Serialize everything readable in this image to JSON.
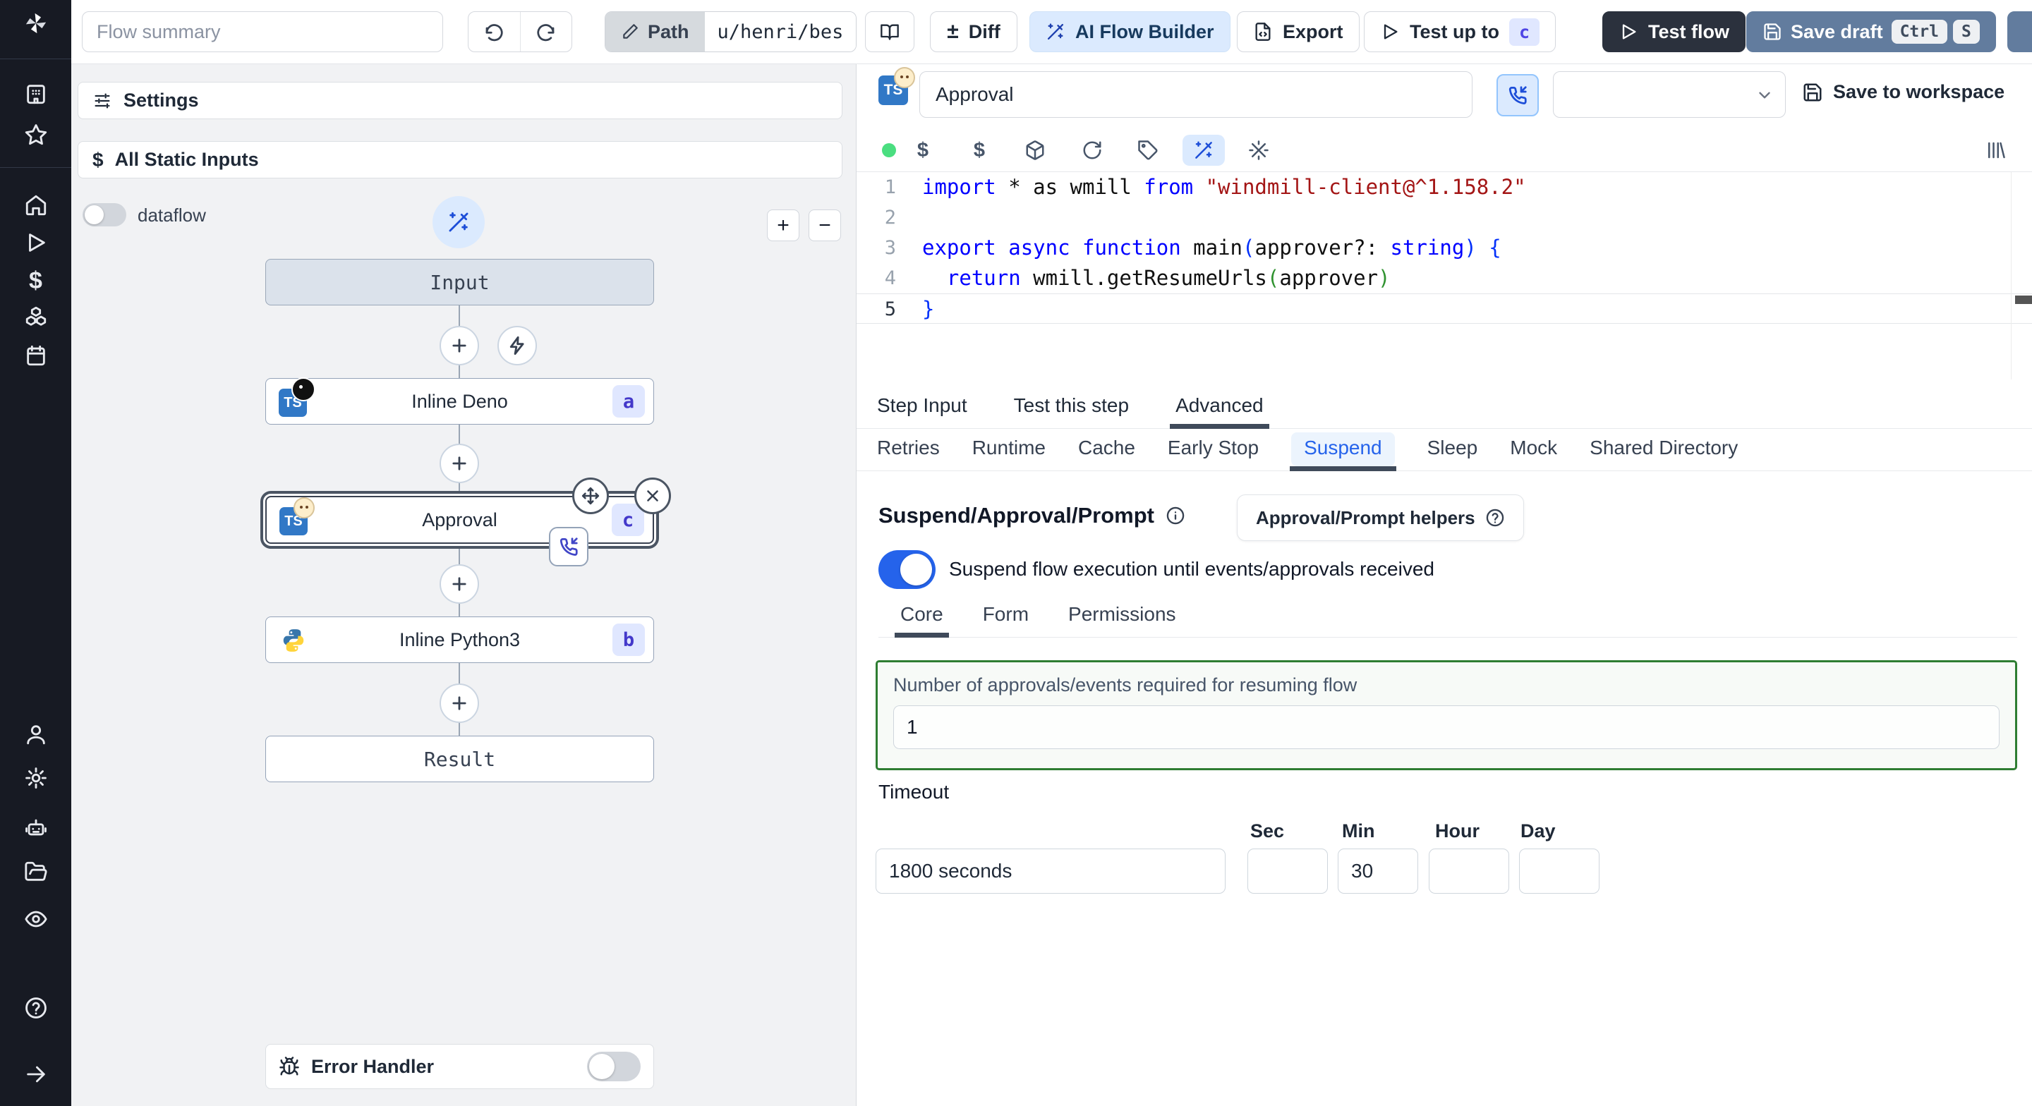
{
  "topbar": {
    "flow_summary_placeholder": "Flow summary",
    "path_label": "Path",
    "path_value": "u/henri/bes",
    "diff_symbol": "±",
    "diff_label": "Diff",
    "ai_label": "AI Flow Builder",
    "export_label": "Export",
    "test_up_to_label": "Test up to",
    "test_up_to_badge": "c",
    "test_flow_label": "Test flow",
    "save_draft_label": "Save draft",
    "save_draft_kbd": [
      "Ctrl",
      "S"
    ]
  },
  "sidebar": {
    "icons": [
      "windmill-logo",
      "workspace-building",
      "favorites-star",
      "home",
      "runs-play",
      "variables-dollar",
      "resources-boxes",
      "schedules-calendar",
      "user",
      "settings-gear",
      "workers-robot",
      "folders",
      "audit-eye",
      "help-question",
      "expand-arrow-right"
    ]
  },
  "left_panel": {
    "settings_label": "Settings",
    "static_inputs_label": "All Static Inputs",
    "dataflow_label": "dataflow",
    "zoom_in": "+",
    "zoom_out": "−",
    "error_handler_label": "Error Handler",
    "dataflow_on": false,
    "error_handler_on": false
  },
  "graph": {
    "input": {
      "label": "Input"
    },
    "deno": {
      "label": "Inline Deno",
      "badge": "a"
    },
    "approval": {
      "label": "Approval",
      "badge": "c",
      "selected": true
    },
    "python": {
      "label": "Inline Python3",
      "badge": "b"
    },
    "result": {
      "label": "Result"
    }
  },
  "editor": {
    "step_name": "Approval",
    "save_to_workspace_label": "Save to workspace",
    "toolbar_icons": [
      "status-dot-green",
      "dollar-var",
      "dollar-var-2",
      "package-box",
      "refresh",
      "tag",
      "magic-wand-active",
      "sparkles-wand",
      "library-columns"
    ],
    "code": {
      "language": "typescript",
      "active_line": 5,
      "lines": [
        {
          "n": 1,
          "tokens": [
            [
              "kw",
              "import"
            ],
            [
              "pl",
              " * as wmill "
            ],
            [
              "kw",
              "from"
            ],
            [
              "pl",
              " "
            ],
            [
              "str",
              "\"windmill-client@^1.158.2\""
            ]
          ]
        },
        {
          "n": 2,
          "tokens": []
        },
        {
          "n": 3,
          "tokens": [
            [
              "kw",
              "export"
            ],
            [
              "pl",
              " "
            ],
            [
              "kw",
              "async"
            ],
            [
              "pl",
              " "
            ],
            [
              "kw",
              "function"
            ],
            [
              "pl",
              " main"
            ],
            [
              "pb",
              "("
            ],
            [
              "pl",
              "approver?: "
            ],
            [
              "kw",
              "string"
            ],
            [
              "pb",
              ")"
            ],
            [
              "pl",
              " "
            ],
            [
              "pb",
              "{"
            ]
          ]
        },
        {
          "n": 4,
          "tokens": [
            [
              "pl",
              "  "
            ],
            [
              "kw",
              "return"
            ],
            [
              "pl",
              " wmill.getResumeUrls"
            ],
            [
              "pg",
              "("
            ],
            [
              "pl",
              "approver"
            ],
            [
              "pg",
              ")"
            ]
          ]
        },
        {
          "n": 5,
          "tokens": [
            [
              "pb",
              "}"
            ]
          ]
        }
      ]
    }
  },
  "tabs": {
    "main": [
      {
        "label": "Step Input",
        "active": false
      },
      {
        "label": "Test this step",
        "active": false
      },
      {
        "label": "Advanced",
        "active": true
      }
    ],
    "advanced": [
      {
        "label": "Retries",
        "active": false
      },
      {
        "label": "Runtime",
        "active": false
      },
      {
        "label": "Cache",
        "active": false
      },
      {
        "label": "Early Stop",
        "active": false
      },
      {
        "label": "Suspend",
        "active": true
      },
      {
        "label": "Sleep",
        "active": false
      },
      {
        "label": "Mock",
        "active": false
      },
      {
        "label": "Shared Directory",
        "active": false
      }
    ],
    "suspend": [
      {
        "label": "Core",
        "active": true
      },
      {
        "label": "Form",
        "active": false
      },
      {
        "label": "Permissions",
        "active": false
      }
    ]
  },
  "suspend_section": {
    "title": "Suspend/Approval/Prompt",
    "helpers_button_label": "Approval/Prompt helpers",
    "toggle_label": "Suspend flow execution until events/approvals received",
    "toggle_on": true,
    "approvals_label": "Number of approvals/events required for resuming flow",
    "approvals_value": "1",
    "timeout_label": "Timeout",
    "timeout_value": "1800 seconds",
    "timeout_units": [
      {
        "label": "Sec",
        "value": ""
      },
      {
        "label": "Min",
        "value": "30"
      },
      {
        "label": "Hour",
        "value": ""
      },
      {
        "label": "Day",
        "value": ""
      }
    ]
  },
  "colors": {
    "sidebar_bg": "#171a23",
    "accent_blue": "#2563eb",
    "ai_button_bg": "#dbeafe",
    "save_draft_bg": "#627c9e",
    "test_flow_bg": "#2b313d",
    "badge_bg": "#e0e7ff",
    "badge_text": "#4338ca",
    "approvals_box_border": "#2e7d32",
    "code_keyword": "#0000ff",
    "code_string": "#a31515"
  }
}
